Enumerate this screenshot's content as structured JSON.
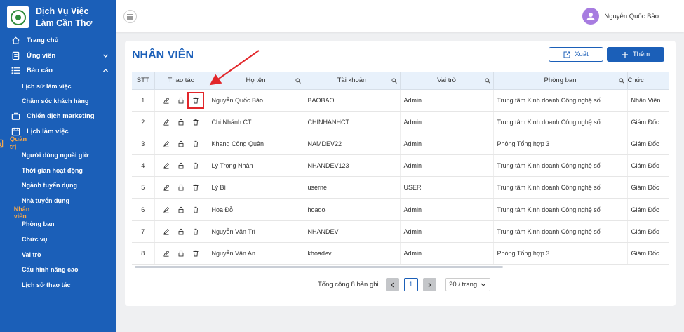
{
  "app": {
    "title": "Dịch Vụ Việc Làm Cần Thơ"
  },
  "sidebar": {
    "items": [
      {
        "label": "Trang chủ",
        "icon": "home-icon"
      },
      {
        "label": "Ứng viên",
        "icon": "document-icon",
        "expandable": true
      },
      {
        "label": "Báo cáo",
        "icon": "list-icon",
        "expandable": true,
        "expanded": true
      },
      {
        "label": "Lịch sử làm việc",
        "sub": true
      },
      {
        "label": "Chăm sóc khách hàng",
        "sub": true
      },
      {
        "label": "Chiến dịch marketing",
        "icon": "briefcase-icon"
      },
      {
        "label": "Lịch làm việc",
        "icon": "calendar-icon"
      },
      {
        "label": "Quản trị",
        "icon": "bar-chart-icon",
        "expandable": true,
        "expanded": true,
        "active": true
      },
      {
        "label": "Người dùng ngoài giờ",
        "sub": true
      },
      {
        "label": "Thời gian hoạt động",
        "sub": true
      },
      {
        "label": "Ngành tuyển dụng",
        "sub": true
      },
      {
        "label": "Nhà tuyển dụng",
        "sub": true
      },
      {
        "label": "Nhân viên",
        "sub": true,
        "active": true
      },
      {
        "label": "Phòng ban",
        "sub": true
      },
      {
        "label": "Chức vụ",
        "sub": true
      },
      {
        "label": "Vai trò",
        "sub": true
      },
      {
        "label": "Cấu hình nâng cao",
        "sub": true
      },
      {
        "label": "Lịch sử thao tác",
        "sub": true
      }
    ],
    "active_color": "#f7a84a"
  },
  "header": {
    "user_name": "Nguyễn Quốc Bảo"
  },
  "main": {
    "page_title": "NHÂN VIÊN",
    "export_label": "Xuất",
    "add_label": "Thêm",
    "columns": [
      "STT",
      "Thao tác",
      "Họ tên",
      "Tài khoản",
      "Vai trò",
      "Phòng ban",
      "Chức"
    ],
    "rows": [
      {
        "stt": "1",
        "name": "Nguyễn Quốc Bảo",
        "account": "BAOBAO",
        "role": "Admin",
        "dept": "Trung tâm Kinh doanh Công nghệ số",
        "position": "Nhân Viên"
      },
      {
        "stt": "2",
        "name": "Chi Nhánh CT",
        "account": "CHINHANHCT",
        "role": "Admin",
        "dept": "Trung tâm Kinh doanh Công nghệ số",
        "position": "Giám Đốc"
      },
      {
        "stt": "3",
        "name": "Khang Công Quân",
        "account": "NAMDEV22",
        "role": "Admin",
        "dept": "Phòng Tổng hợp 3",
        "position": "Giám Đốc"
      },
      {
        "stt": "4",
        "name": "Lý Trọng Nhân",
        "account": "NHANDEV123",
        "role": "Admin",
        "dept": "Trung tâm Kinh doanh Công nghệ số",
        "position": "Giám Đốc"
      },
      {
        "stt": "5",
        "name": "Lý Bí",
        "account": "userne",
        "role": "USER",
        "dept": "Trung tâm Kinh doanh Công nghệ số",
        "position": "Giám Đốc"
      },
      {
        "stt": "6",
        "name": "Hoa Đỗ",
        "account": "hoado",
        "role": "Admin",
        "dept": "Trung tâm Kinh doanh Công nghệ số",
        "position": "Giám Đốc"
      },
      {
        "stt": "7",
        "name": "Nguyễn Văn Trí",
        "account": "NHANDEV",
        "role": "Admin",
        "dept": "Trung tâm Kinh doanh Công nghệ số",
        "position": "Giám Đốc"
      },
      {
        "stt": "8",
        "name": "Nguyễn Văn An",
        "account": "khoadev",
        "role": "Admin",
        "dept": "Phòng Tổng hợp 3",
        "position": "Giám Đốc"
      }
    ],
    "row_actions": [
      "edit-icon",
      "lock-icon",
      "delete-icon"
    ],
    "highlighted_action": "delete-icon on row 1"
  },
  "pagination": {
    "total_text": "Tổng cộng 8 bản ghi",
    "current_page": "1",
    "page_size": "20 / trang"
  },
  "colors": {
    "primary": "#1b5fb8",
    "header_bg": "#e8f1fb",
    "annotation": "#e2262a"
  }
}
